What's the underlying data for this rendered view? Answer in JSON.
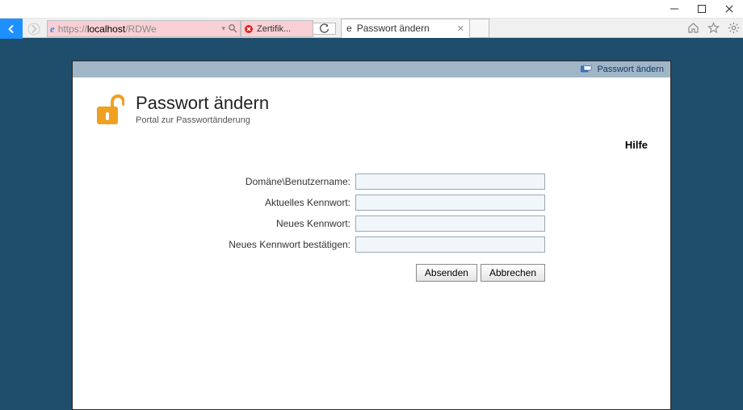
{
  "window": {
    "controls": {
      "minimize": "minimize",
      "maximize": "maximize",
      "close": "close"
    }
  },
  "browser": {
    "url_prefix": "https://",
    "url_host": "localhost",
    "url_rest": "/RDWe",
    "search_hint_label": "Zertifik...",
    "tab_title": "Passwort ändern",
    "right_icons": {
      "home": "home",
      "favorites": "favorites",
      "tools": "tools"
    }
  },
  "page": {
    "toplink_label": "Passwort ändern",
    "heading": "Passwort ändern",
    "subheading": "Portal zur Passwortänderung",
    "help_label": "Hilfe",
    "form": {
      "username_label": "Domäne\\Benutzername:",
      "current_pw_label": "Aktuelles Kennwort:",
      "new_pw_label": "Neues Kennwort:",
      "confirm_pw_label": "Neues Kennwort bestätigen:",
      "username_value": "",
      "current_pw_value": "",
      "new_pw_value": "",
      "confirm_pw_value": ""
    },
    "buttons": {
      "submit_label": "Absenden",
      "cancel_label": "Abbrechen"
    }
  }
}
